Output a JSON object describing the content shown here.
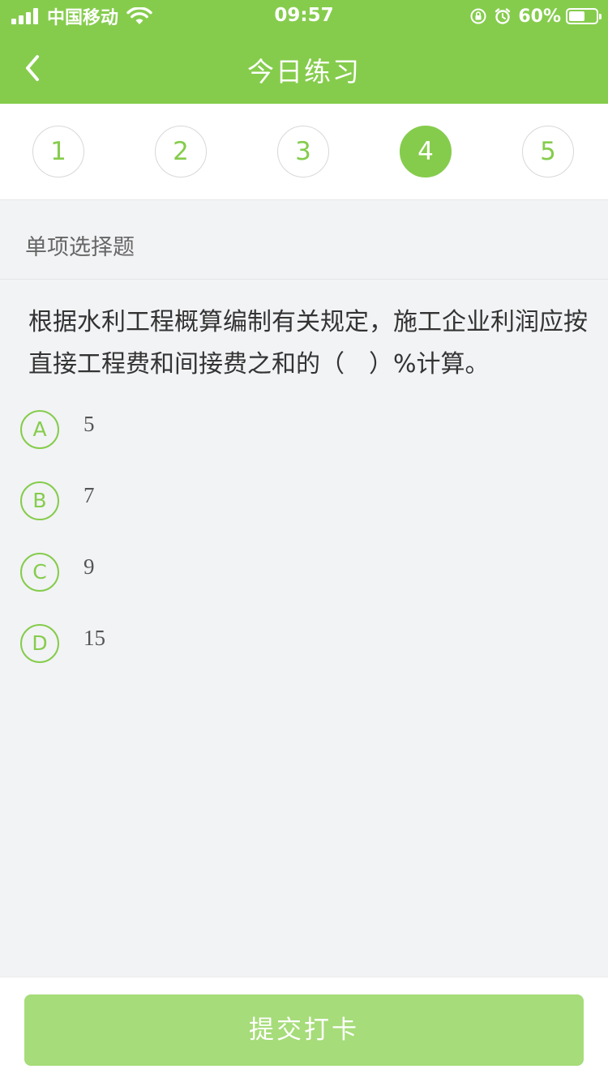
{
  "status_bar": {
    "carrier": "中国移动",
    "time": "09:57",
    "battery_percent": "60%",
    "battery_level": 0.6,
    "icons": [
      "signal-icon",
      "wifi-icon",
      "orientation-lock-icon",
      "alarm-icon",
      "battery-icon"
    ]
  },
  "header": {
    "title": "今日练习",
    "back_icon": "chevron-left-icon",
    "color": "#85cc4c"
  },
  "steps": {
    "items": [
      "1",
      "2",
      "3",
      "4",
      "5"
    ],
    "active_index": 3
  },
  "question": {
    "type": "单项选择题",
    "text": "根据水利工程概算编制有关规定，施工企业利润应按直接工程费和间接费之和的（　）%计算。",
    "options": [
      {
        "letter": "A",
        "text": "5"
      },
      {
        "letter": "B",
        "text": "7"
      },
      {
        "letter": "C",
        "text": "9"
      },
      {
        "letter": "D",
        "text": "15"
      }
    ]
  },
  "footer": {
    "submit_label": "提交打卡",
    "submit_color": "#a6dc79"
  }
}
